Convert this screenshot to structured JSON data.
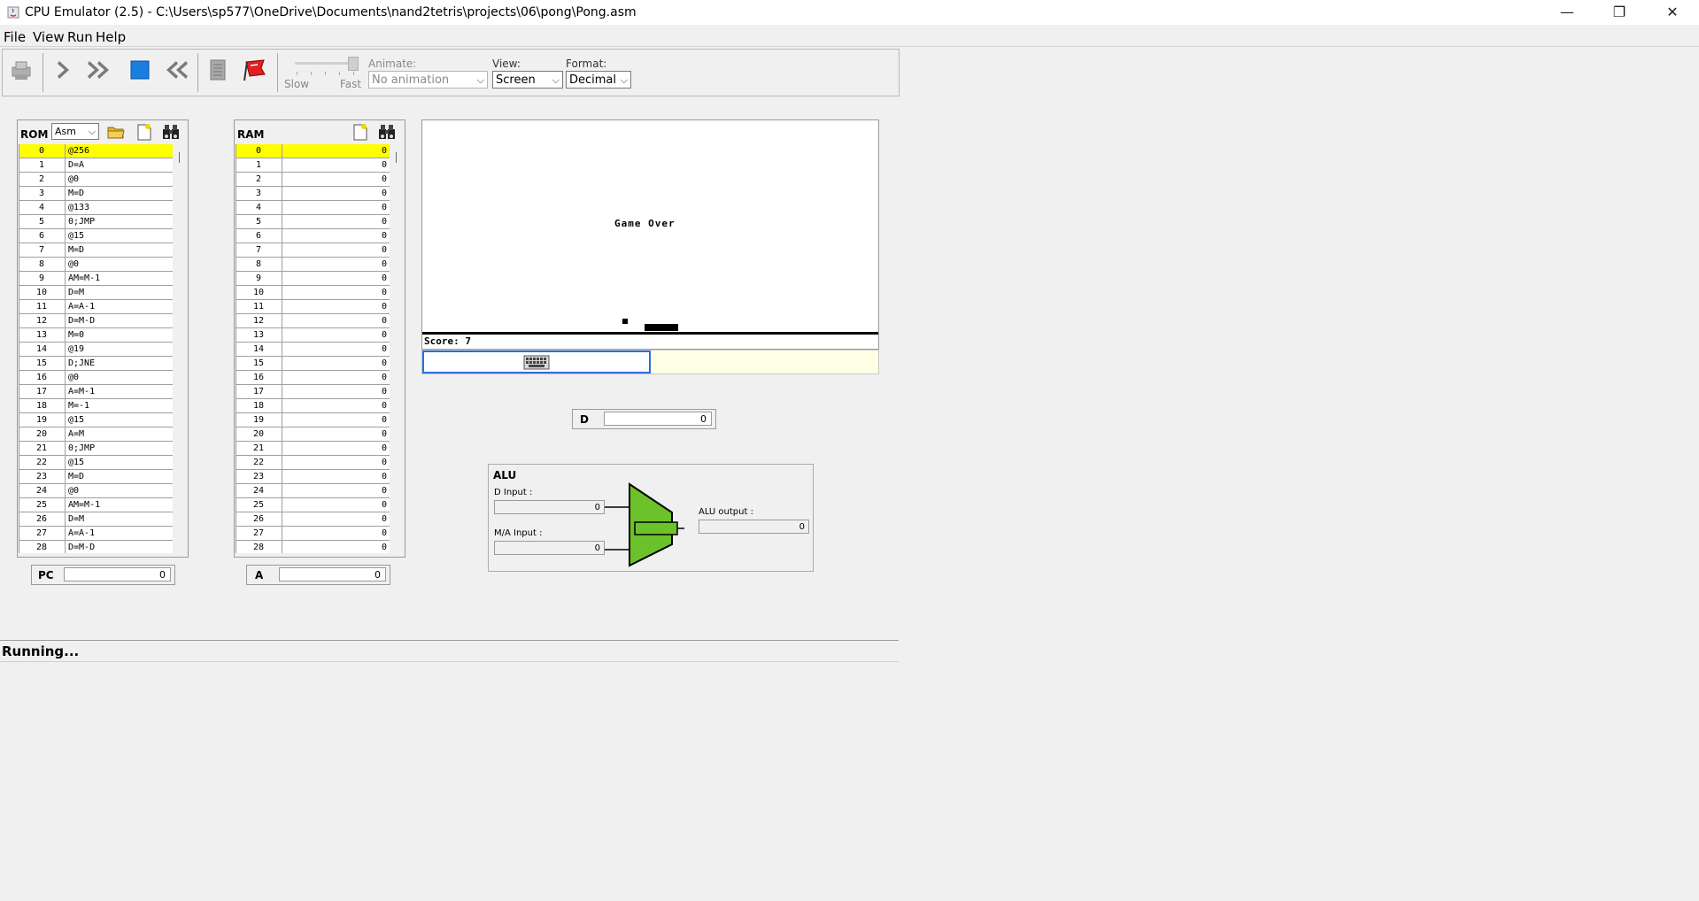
{
  "window": {
    "title": "CPU Emulator (2.5) - C:\\Users\\sp577\\OneDrive\\Documents\\nand2tetris\\projects\\06\\pong\\Pong.asm",
    "minimize": "—",
    "maximize": "❐",
    "close": "✕"
  },
  "menu": [
    "File",
    "View",
    "Run",
    "Help"
  ],
  "toolbar": {
    "speed_slow": "Slow",
    "speed_fast": "Fast",
    "animate_label": "Animate:",
    "animate_value": "No animation",
    "view_label": "View:",
    "view_value": "Screen",
    "format_label": "Format:",
    "format_value": "Decimal"
  },
  "rom": {
    "label": "ROM",
    "format_value": "Asm",
    "rows": [
      {
        "i": "0",
        "c": "@256"
      },
      {
        "i": "1",
        "c": "D=A"
      },
      {
        "i": "2",
        "c": "@0"
      },
      {
        "i": "3",
        "c": "M=D"
      },
      {
        "i": "4",
        "c": "@133"
      },
      {
        "i": "5",
        "c": "0;JMP"
      },
      {
        "i": "6",
        "c": "@15"
      },
      {
        "i": "7",
        "c": "M=D"
      },
      {
        "i": "8",
        "c": "@0"
      },
      {
        "i": "9",
        "c": "AM=M-1"
      },
      {
        "i": "10",
        "c": "D=M"
      },
      {
        "i": "11",
        "c": "A=A-1"
      },
      {
        "i": "12",
        "c": "D=M-D"
      },
      {
        "i": "13",
        "c": "M=0"
      },
      {
        "i": "14",
        "c": "@19"
      },
      {
        "i": "15",
        "c": "D;JNE"
      },
      {
        "i": "16",
        "c": "@0"
      },
      {
        "i": "17",
        "c": "A=M-1"
      },
      {
        "i": "18",
        "c": "M=-1"
      },
      {
        "i": "19",
        "c": "@15"
      },
      {
        "i": "20",
        "c": "A=M"
      },
      {
        "i": "21",
        "c": "0;JMP"
      },
      {
        "i": "22",
        "c": "@15"
      },
      {
        "i": "23",
        "c": "M=D"
      },
      {
        "i": "24",
        "c": "@0"
      },
      {
        "i": "25",
        "c": "AM=M-1"
      },
      {
        "i": "26",
        "c": "D=M"
      },
      {
        "i": "27",
        "c": "A=A-1"
      },
      {
        "i": "28",
        "c": "D=M-D"
      }
    ]
  },
  "ram": {
    "label": "RAM",
    "rows": [
      {
        "i": "0",
        "v": "0"
      },
      {
        "i": "1",
        "v": "0"
      },
      {
        "i": "2",
        "v": "0"
      },
      {
        "i": "3",
        "v": "0"
      },
      {
        "i": "4",
        "v": "0"
      },
      {
        "i": "5",
        "v": "0"
      },
      {
        "i": "6",
        "v": "0"
      },
      {
        "i": "7",
        "v": "0"
      },
      {
        "i": "8",
        "v": "0"
      },
      {
        "i": "9",
        "v": "0"
      },
      {
        "i": "10",
        "v": "0"
      },
      {
        "i": "11",
        "v": "0"
      },
      {
        "i": "12",
        "v": "0"
      },
      {
        "i": "13",
        "v": "0"
      },
      {
        "i": "14",
        "v": "0"
      },
      {
        "i": "15",
        "v": "0"
      },
      {
        "i": "16",
        "v": "0"
      },
      {
        "i": "17",
        "v": "0"
      },
      {
        "i": "18",
        "v": "0"
      },
      {
        "i": "19",
        "v": "0"
      },
      {
        "i": "20",
        "v": "0"
      },
      {
        "i": "21",
        "v": "0"
      },
      {
        "i": "22",
        "v": "0"
      },
      {
        "i": "23",
        "v": "0"
      },
      {
        "i": "24",
        "v": "0"
      },
      {
        "i": "25",
        "v": "0"
      },
      {
        "i": "26",
        "v": "0"
      },
      {
        "i": "27",
        "v": "0"
      },
      {
        "i": "28",
        "v": "0"
      }
    ]
  },
  "screen": {
    "message": "Game Over",
    "score": "Score: 7"
  },
  "registers": {
    "pc_label": "PC",
    "pc_value": "0",
    "a_label": "A",
    "a_value": "0",
    "d_label": "D",
    "d_value": "0"
  },
  "alu": {
    "title": "ALU",
    "d_input_label": "D Input :",
    "d_input_value": "0",
    "ma_input_label": "M/A Input :",
    "ma_input_value": "0",
    "output_label": "ALU output :",
    "output_value": "0"
  },
  "status": "Running...",
  "colors": {
    "highlight": "#ffff00",
    "alu_fill": "#6cc22a"
  }
}
